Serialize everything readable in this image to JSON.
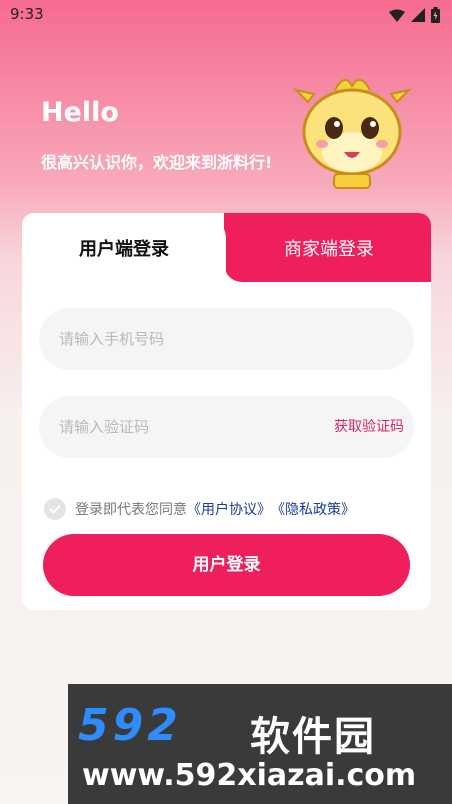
{
  "status_bar": {
    "time": "9:33"
  },
  "header": {
    "greeting": "Hello",
    "subtitle": "很高兴认识你，欢迎来到浙料行!"
  },
  "tabs": {
    "user_login": "用户端登录",
    "merchant_login": "商家端登录"
  },
  "form": {
    "phone_placeholder": "请输入手机号码",
    "code_placeholder": "请输入验证码",
    "get_code": "获取验证码"
  },
  "agreement": {
    "prefix": "登录即代表您同意",
    "user_agreement": "《用户协议》",
    "privacy_policy": "《隐私政策》"
  },
  "login_button": "用户登录",
  "watermark": {
    "logo": "592",
    "name": "软件园",
    "url": "www.592xiazai.com"
  },
  "colors": {
    "accent": "#ef1f5b",
    "link": "#1f3c9a",
    "mascot": "#f6cf3a"
  }
}
